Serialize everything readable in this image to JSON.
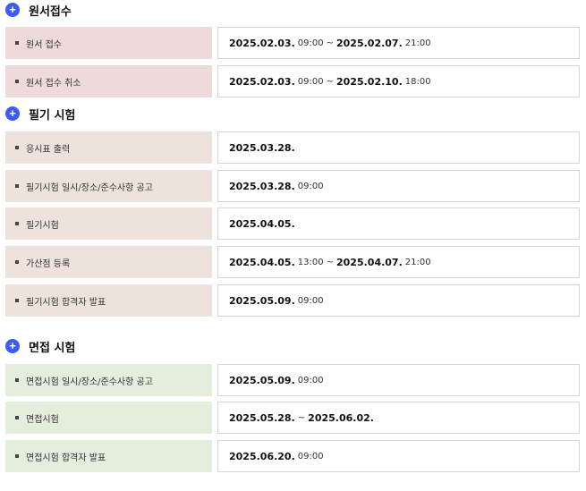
{
  "sections": [
    {
      "title": "원서접수",
      "rows": [
        {
          "label": "원서 접수",
          "start_date": "2025.02.03.",
          "start_time": "09:00",
          "sep": "~",
          "end_date": "2025.02.07.",
          "end_time": "21:00"
        },
        {
          "label": "원서 접수 취소",
          "start_date": "2025.02.03.",
          "start_time": "09:00",
          "sep": "~",
          "end_date": "2025.02.10.",
          "end_time": "18:00"
        }
      ]
    },
    {
      "title": "필기 시험",
      "rows": [
        {
          "label": "응시표 출력",
          "start_date": "2025.03.28."
        },
        {
          "label": "필기시험 일시/장소/준수사항 공고",
          "start_date": "2025.03.28.",
          "start_time": "09:00"
        },
        {
          "label": "필기시험",
          "start_date": "2025.04.05."
        },
        {
          "label": "가산점 등록",
          "start_date": "2025.04.05.",
          "start_time": "13:00",
          "sep": "~",
          "end_date": "2025.04.07.",
          "end_time": "21:00"
        },
        {
          "label": "필기시험 합격자 발표",
          "start_date": "2025.05.09.",
          "start_time": "09:00"
        }
      ]
    },
    {
      "title": "면접 시험",
      "rows": [
        {
          "label": "면접시험 일시/장소/준수사항 공고",
          "start_date": "2025.05.09.",
          "start_time": "09:00"
        },
        {
          "label": "면접시험",
          "start_date": "2025.05.28.",
          "sep": "~",
          "end_date": "2025.06.02."
        },
        {
          "label": "면접시험 합격자 발표",
          "start_date": "2025.06.20.",
          "start_time": "09:00"
        }
      ]
    }
  ],
  "colors": {
    "plus_icon": "#3d5afe",
    "section1_label_bg": "#eedada",
    "section2_label_bg": "#ede3dc",
    "section3_label_bg": "#e5eddc"
  }
}
